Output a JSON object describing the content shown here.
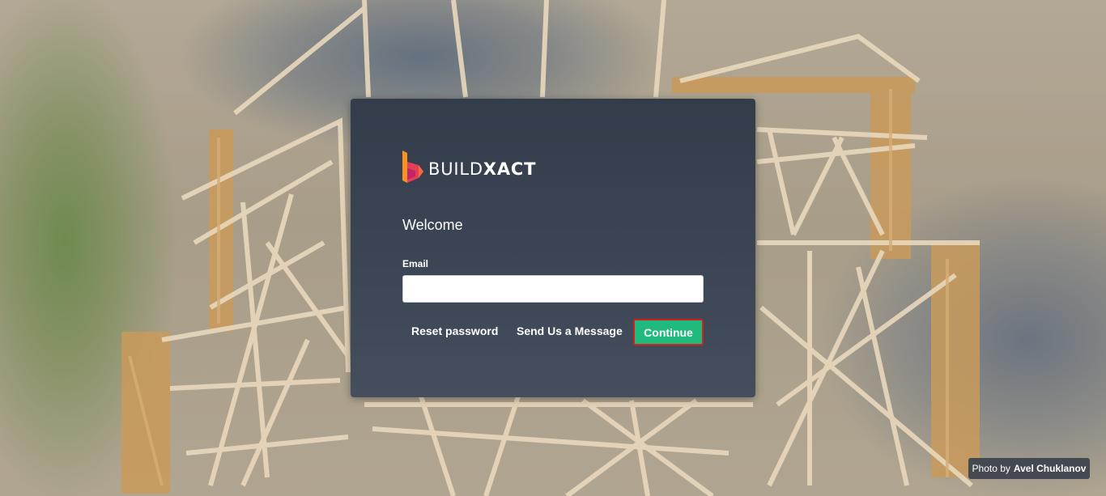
{
  "brand": {
    "name_part1": "BUILD",
    "name_part2": "XACT",
    "logo_icon": "buildxact-b-logo-icon",
    "colors": {
      "logo_orange": "#f7931e",
      "logo_pink": "#e23e57",
      "logo_magenta": "#c1246b"
    }
  },
  "login": {
    "heading": "Welcome",
    "email_label": "Email",
    "email_value": "",
    "email_placeholder": "",
    "reset_password_link": "Reset password",
    "send_message_link": "Send Us a Message",
    "continue_button": "Continue"
  },
  "photo_credit": {
    "prefix": "Photo by",
    "author": "Avel Chuklanov"
  },
  "colors": {
    "card_background": "#3a4351",
    "continue_button": "#1fba7c",
    "continue_focus_border": "#d21f1f"
  }
}
